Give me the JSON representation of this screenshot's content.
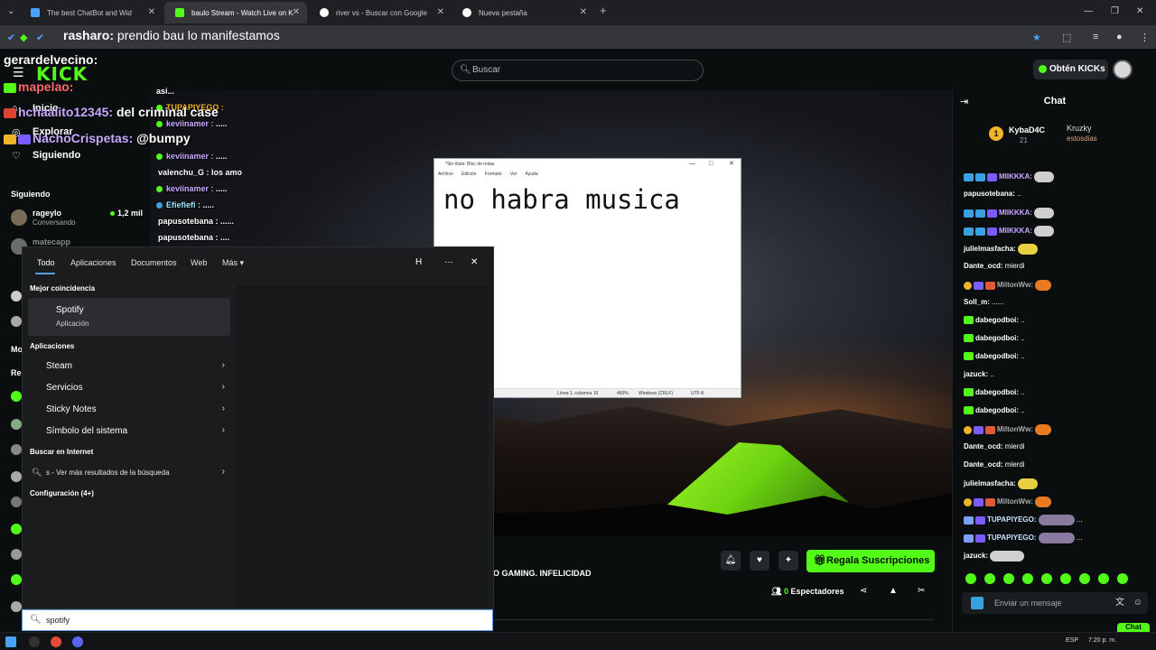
{
  "browser": {
    "tabs": [
      {
        "title": "The best ChatBot and Wid",
        "color": "#4aa3ff"
      },
      {
        "title": "baulo Stream - Watch Live on K",
        "color": "#53fc18"
      },
      {
        "title": "river vs - Buscar con Google",
        "color": "#ffffff"
      },
      {
        "title": "Nueva pestaña",
        "color": "#ffffff"
      }
    ],
    "newtab": "+",
    "url_overlay_user": "rasharo:",
    "url_overlay_text": " prendio bau lo manifestamos"
  },
  "overlay_big": [
    {
      "user": "gerardelvecino:",
      "text": ""
    },
    {
      "user": "mapelao:",
      "text": ""
    },
    {
      "user": "hchaalito12345:",
      "text": " del criminal case"
    },
    {
      "user": "NachoCrispetas:",
      "text": " @bumpy"
    }
  ],
  "kick": {
    "logo": "KICK",
    "search_placeholder": "Buscar",
    "kicks_button": "Obtén KICKs"
  },
  "sidebar": {
    "links": [
      "Inicio",
      "Explorar",
      "Siguiendo"
    ],
    "following_header": "Siguiendo",
    "channels": [
      {
        "name": "rageylo",
        "category": "Conversando",
        "viewers": "1,2 mil"
      },
      {
        "name": "matecapp",
        "category": "",
        "viewers": ""
      }
    ],
    "partial_headers": [
      "Mo",
      "Re"
    ]
  },
  "stream_overlay_chat": [
    {
      "user": "asi...",
      "text": ""
    },
    {
      "user": "TUPAPIYEGO :",
      "text": ""
    },
    {
      "user": "keviinamer :",
      "text": " ....."
    },
    {
      "user": "keviinamer :",
      "text": " ....."
    },
    {
      "user": "valenchu_G :",
      "text": " los amo"
    },
    {
      "user": "keviinamer :",
      "text": " ....."
    },
    {
      "user": "Efiefiefi :",
      "text": " ....."
    },
    {
      "user": "papusotebana :",
      "text": " ......"
    },
    {
      "user": "papusotebana :",
      "text": " ...."
    }
  ],
  "notepad": {
    "title": "*Sin título: Bloc de notas",
    "menu": [
      "Archivo",
      "Edición",
      "Formato",
      "Ver",
      "Ayuda"
    ],
    "content": "no habra musica",
    "status": {
      "pos": "Línea 1, columna 16",
      "zoom": "460%",
      "eol": "Windows (CRLF)",
      "enc": "UTF-8"
    }
  },
  "stream_info": {
    "title": "O GAMING. INFELICIDAD",
    "subscribe_label": "Regala Suscripciones",
    "viewers_count": "0",
    "viewers_label": " Espectadores"
  },
  "chat": {
    "title": "Chat",
    "pinned": {
      "user": "KybaD4C",
      "sub": "21",
      "user2": "Kruzky",
      "sub2": "estosdias",
      "rank": "1"
    },
    "messages": [
      {
        "user": "MIIKKKA:",
        "text": "",
        "color": "#c9a9ff"
      },
      {
        "user": "papusotebana:",
        "text": " ..",
        "color": "#ffffff"
      },
      {
        "user": "MIIKKKA:",
        "text": "",
        "color": "#c9a9ff"
      },
      {
        "user": "MIIKKKA:",
        "text": "",
        "color": "#c9a9ff"
      },
      {
        "user": "julielmasfacha:",
        "text": "",
        "color": "#ffffff"
      },
      {
        "user": "Dante_ocd:",
        "text": " mierdi",
        "color": "#ffffff"
      },
      {
        "user": "MiltonWw:",
        "text": "",
        "color": "#aaaaaa"
      },
      {
        "user": "Soll_m:",
        "text": " ......",
        "color": "#ffffff"
      },
      {
        "user": "dabegodboi:",
        "text": " ..",
        "color": "#ffffff"
      },
      {
        "user": "dabegodboi:",
        "text": " ..",
        "color": "#ffffff"
      },
      {
        "user": "dabegodboi:",
        "text": " ..",
        "color": "#ffffff"
      },
      {
        "user": "jazuck:",
        "text": " ..",
        "color": "#ffffff"
      },
      {
        "user": "dabegodboi:",
        "text": " ..",
        "color": "#ffffff"
      },
      {
        "user": "dabegodboi:",
        "text": " ..",
        "color": "#ffffff"
      },
      {
        "user": "MiltonWw:",
        "text": "",
        "color": "#aaaaaa"
      },
      {
        "user": "Dante_ocd:",
        "text": " mierdi",
        "color": "#ffffff"
      },
      {
        "user": "Dante_ocd:",
        "text": " mierdi",
        "color": "#ffffff"
      },
      {
        "user": "julielmasfacha:",
        "text": "",
        "color": "#ffffff"
      },
      {
        "user": "MiltonWw:",
        "text": "",
        "color": "#aaaaaa"
      },
      {
        "user": "TUPAPIYEGO:",
        "text": " ...",
        "color": "#c9e3ff"
      },
      {
        "user": "TUPAPIYEGO:",
        "text": " ...",
        "color": "#c9e3ff"
      },
      {
        "user": "jazuck:",
        "text": "",
        "color": "#ffffff"
      }
    ],
    "input_placeholder": "Enviar un mensaje",
    "send_button": "Chat"
  },
  "startmenu": {
    "tabs": [
      "Todo",
      "Aplicaciones",
      "Documentos",
      "Web",
      "Más ▾"
    ],
    "icon_h": "H",
    "more_icon": "···",
    "close_icon": "✕",
    "best_match_header": "Mejor coincidencia",
    "best_match": {
      "name": "Spotify",
      "sub": "Aplicación"
    },
    "apps_header": "Aplicaciones",
    "apps": [
      "Steam",
      "Servicios",
      "Sticky Notes",
      "Símbolo del sistema"
    ],
    "internet_header": "Buscar en Internet",
    "web_result": "s - Ver más resultados de la búsqueda",
    "settings_header": "Configuración (4+)",
    "search_value": "spotify"
  },
  "taskbar": {
    "lang": "ESP",
    "time": "7:20 p. m."
  }
}
